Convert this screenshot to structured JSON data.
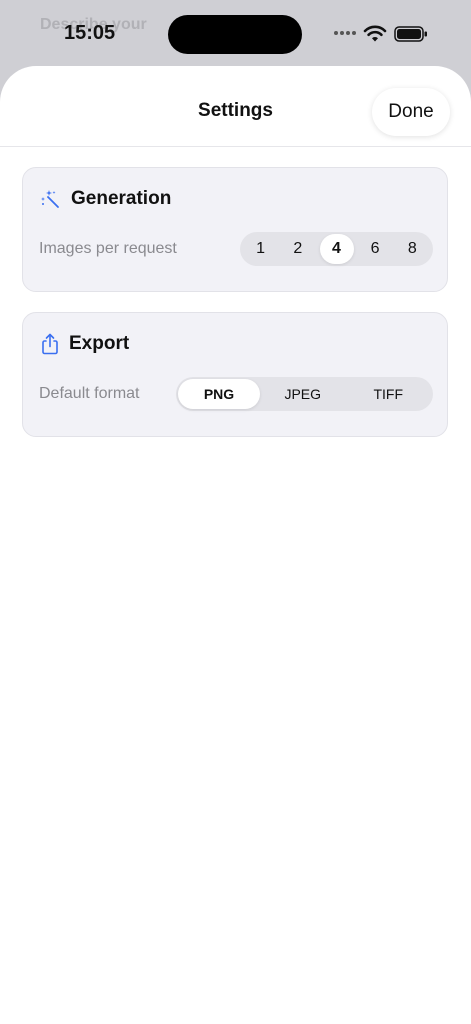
{
  "status_bar": {
    "time": "15:05"
  },
  "background": {
    "peek_text": "Describe your"
  },
  "header": {
    "title": "Settings",
    "done_label": "Done"
  },
  "generation": {
    "title": "Generation",
    "icon": "magic-wand-icon",
    "row_label": "Images per request",
    "options": [
      "1",
      "2",
      "4",
      "6",
      "8"
    ],
    "selected": "4"
  },
  "export": {
    "title": "Export",
    "icon": "share-icon",
    "row_label": "Default format",
    "options": [
      "PNG",
      "JPEG",
      "TIFF"
    ],
    "selected": "PNG"
  },
  "colors": {
    "accent": "#3a6ff0",
    "card_bg": "#f2f2f7",
    "segment_bg": "#e3e3e8"
  }
}
